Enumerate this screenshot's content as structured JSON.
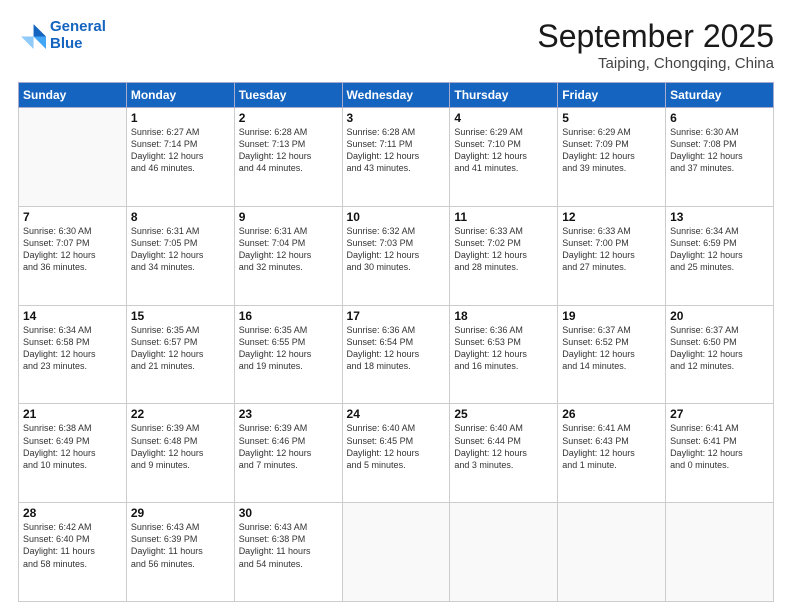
{
  "header": {
    "logo_line1": "General",
    "logo_line2": "Blue",
    "month": "September 2025",
    "location": "Taiping, Chongqing, China"
  },
  "weekdays": [
    "Sunday",
    "Monday",
    "Tuesday",
    "Wednesday",
    "Thursday",
    "Friday",
    "Saturday"
  ],
  "weeks": [
    [
      {
        "day": "",
        "content": ""
      },
      {
        "day": "1",
        "content": "Sunrise: 6:27 AM\nSunset: 7:14 PM\nDaylight: 12 hours\nand 46 minutes."
      },
      {
        "day": "2",
        "content": "Sunrise: 6:28 AM\nSunset: 7:13 PM\nDaylight: 12 hours\nand 44 minutes."
      },
      {
        "day": "3",
        "content": "Sunrise: 6:28 AM\nSunset: 7:11 PM\nDaylight: 12 hours\nand 43 minutes."
      },
      {
        "day": "4",
        "content": "Sunrise: 6:29 AM\nSunset: 7:10 PM\nDaylight: 12 hours\nand 41 minutes."
      },
      {
        "day": "5",
        "content": "Sunrise: 6:29 AM\nSunset: 7:09 PM\nDaylight: 12 hours\nand 39 minutes."
      },
      {
        "day": "6",
        "content": "Sunrise: 6:30 AM\nSunset: 7:08 PM\nDaylight: 12 hours\nand 37 minutes."
      }
    ],
    [
      {
        "day": "7",
        "content": "Sunrise: 6:30 AM\nSunset: 7:07 PM\nDaylight: 12 hours\nand 36 minutes."
      },
      {
        "day": "8",
        "content": "Sunrise: 6:31 AM\nSunset: 7:05 PM\nDaylight: 12 hours\nand 34 minutes."
      },
      {
        "day": "9",
        "content": "Sunrise: 6:31 AM\nSunset: 7:04 PM\nDaylight: 12 hours\nand 32 minutes."
      },
      {
        "day": "10",
        "content": "Sunrise: 6:32 AM\nSunset: 7:03 PM\nDaylight: 12 hours\nand 30 minutes."
      },
      {
        "day": "11",
        "content": "Sunrise: 6:33 AM\nSunset: 7:02 PM\nDaylight: 12 hours\nand 28 minutes."
      },
      {
        "day": "12",
        "content": "Sunrise: 6:33 AM\nSunset: 7:00 PM\nDaylight: 12 hours\nand 27 minutes."
      },
      {
        "day": "13",
        "content": "Sunrise: 6:34 AM\nSunset: 6:59 PM\nDaylight: 12 hours\nand 25 minutes."
      }
    ],
    [
      {
        "day": "14",
        "content": "Sunrise: 6:34 AM\nSunset: 6:58 PM\nDaylight: 12 hours\nand 23 minutes."
      },
      {
        "day": "15",
        "content": "Sunrise: 6:35 AM\nSunset: 6:57 PM\nDaylight: 12 hours\nand 21 minutes."
      },
      {
        "day": "16",
        "content": "Sunrise: 6:35 AM\nSunset: 6:55 PM\nDaylight: 12 hours\nand 19 minutes."
      },
      {
        "day": "17",
        "content": "Sunrise: 6:36 AM\nSunset: 6:54 PM\nDaylight: 12 hours\nand 18 minutes."
      },
      {
        "day": "18",
        "content": "Sunrise: 6:36 AM\nSunset: 6:53 PM\nDaylight: 12 hours\nand 16 minutes."
      },
      {
        "day": "19",
        "content": "Sunrise: 6:37 AM\nSunset: 6:52 PM\nDaylight: 12 hours\nand 14 minutes."
      },
      {
        "day": "20",
        "content": "Sunrise: 6:37 AM\nSunset: 6:50 PM\nDaylight: 12 hours\nand 12 minutes."
      }
    ],
    [
      {
        "day": "21",
        "content": "Sunrise: 6:38 AM\nSunset: 6:49 PM\nDaylight: 12 hours\nand 10 minutes."
      },
      {
        "day": "22",
        "content": "Sunrise: 6:39 AM\nSunset: 6:48 PM\nDaylight: 12 hours\nand 9 minutes."
      },
      {
        "day": "23",
        "content": "Sunrise: 6:39 AM\nSunset: 6:46 PM\nDaylight: 12 hours\nand 7 minutes."
      },
      {
        "day": "24",
        "content": "Sunrise: 6:40 AM\nSunset: 6:45 PM\nDaylight: 12 hours\nand 5 minutes."
      },
      {
        "day": "25",
        "content": "Sunrise: 6:40 AM\nSunset: 6:44 PM\nDaylight: 12 hours\nand 3 minutes."
      },
      {
        "day": "26",
        "content": "Sunrise: 6:41 AM\nSunset: 6:43 PM\nDaylight: 12 hours\nand 1 minute."
      },
      {
        "day": "27",
        "content": "Sunrise: 6:41 AM\nSunset: 6:41 PM\nDaylight: 12 hours\nand 0 minutes."
      }
    ],
    [
      {
        "day": "28",
        "content": "Sunrise: 6:42 AM\nSunset: 6:40 PM\nDaylight: 11 hours\nand 58 minutes."
      },
      {
        "day": "29",
        "content": "Sunrise: 6:43 AM\nSunset: 6:39 PM\nDaylight: 11 hours\nand 56 minutes."
      },
      {
        "day": "30",
        "content": "Sunrise: 6:43 AM\nSunset: 6:38 PM\nDaylight: 11 hours\nand 54 minutes."
      },
      {
        "day": "",
        "content": ""
      },
      {
        "day": "",
        "content": ""
      },
      {
        "day": "",
        "content": ""
      },
      {
        "day": "",
        "content": ""
      }
    ]
  ]
}
